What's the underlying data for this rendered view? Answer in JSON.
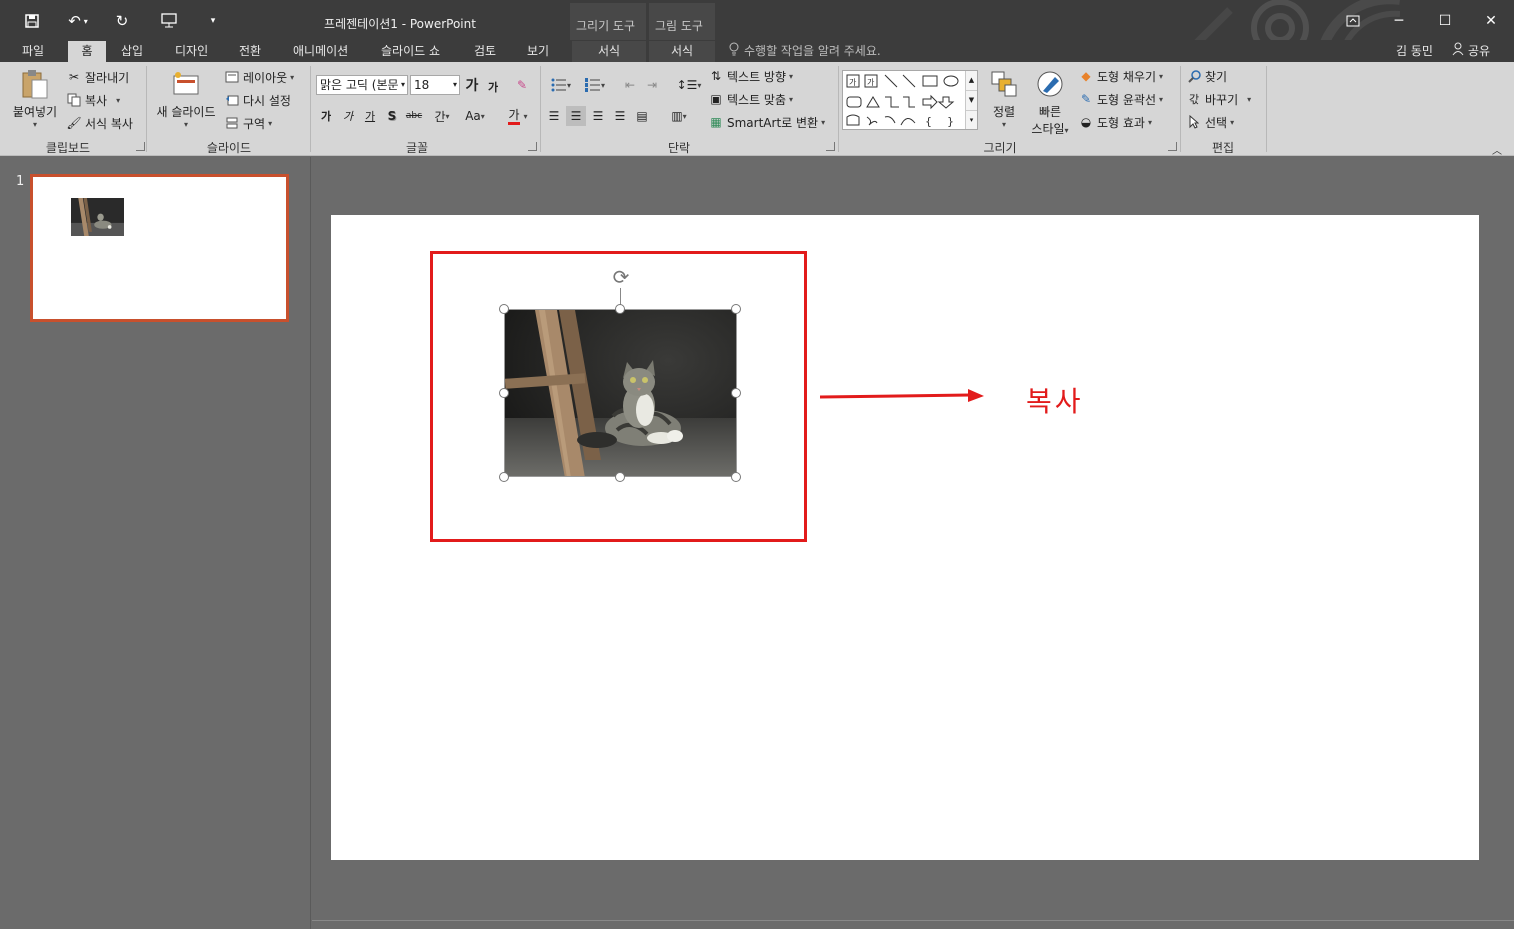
{
  "window": {
    "title": "프레젠테이션1 - PowerPoint",
    "context_tabs": [
      {
        "group": "그리기 도구",
        "tab": "서식"
      },
      {
        "group": "그림 도구",
        "tab": "서식"
      }
    ]
  },
  "quick_access": {
    "icons": [
      "save-icon",
      "undo-icon",
      "redo-icon",
      "start-from-beginning-icon",
      "customize-icon"
    ]
  },
  "tabs": [
    "파일",
    "홈",
    "삽입",
    "디자인",
    "전환",
    "애니메이션",
    "슬라이드 쇼",
    "검토",
    "보기"
  ],
  "active_tab": "홈",
  "tell_me": "수행할 작업을 알려 주세요.",
  "user": {
    "name": "김 동민",
    "share": "공유"
  },
  "ribbon": {
    "clipboard": {
      "label": "클립보드",
      "paste": "붙여넣기",
      "cut": "잘라내기",
      "copy": "복사",
      "format_painter": "서식 복사"
    },
    "slides": {
      "label": "슬라이드",
      "new_slide": "새 슬라이드",
      "layout": "레이아웃",
      "reset": "다시 설정",
      "section": "구역"
    },
    "font": {
      "label": "글꼴",
      "font_name": "맑은 고딕 (본문",
      "font_size": "18",
      "grow": "가",
      "shrink": "가",
      "bold": "가",
      "italic": "가",
      "underline": "가",
      "shadow": "S",
      "strike": "abc",
      "spacing": "간",
      "case": "Aa",
      "color": "가"
    },
    "paragraph": {
      "label": "단락",
      "text_direction": "텍스트 방향",
      "align_text": "텍스트 맞춤",
      "smartart": "SmartArt로 변환"
    },
    "drawing": {
      "label": "그리기",
      "arrange": "정렬",
      "quick_styles_1": "빠른",
      "quick_styles_2": "스타일",
      "shape_fill": "도형 채우기",
      "shape_outline": "도형 윤곽선",
      "shape_effects": "도형 효과"
    },
    "editing": {
      "label": "편집",
      "find": "찾기",
      "replace": "바꾸기",
      "select": "선택"
    }
  },
  "thumbnails": [
    {
      "number": "1"
    }
  ],
  "annotation": {
    "text": "복사",
    "color": "#e21b1b"
  },
  "colors": {
    "accent": "#c8502d",
    "titlebar": "#3c3c3c",
    "ribbon": "#d6d6d6"
  }
}
